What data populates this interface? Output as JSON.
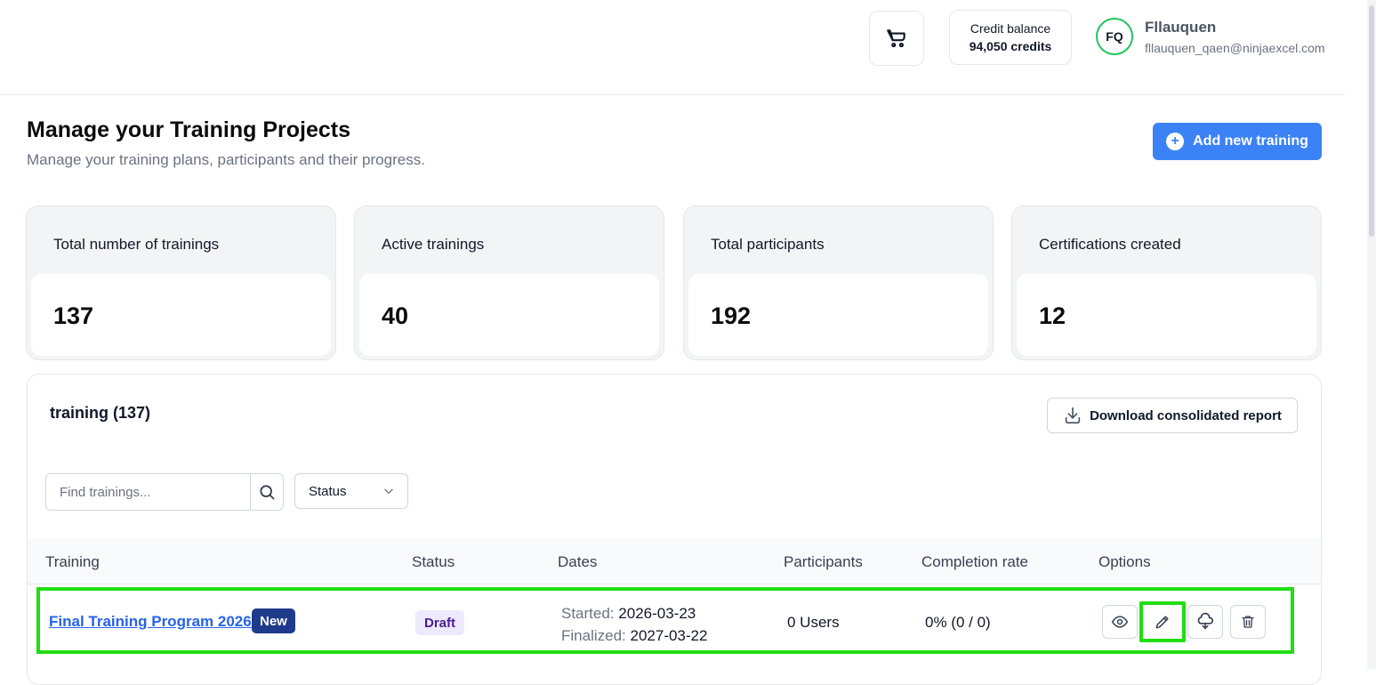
{
  "header": {
    "credit_label": "Credit balance",
    "credit_value": "94,050 credits",
    "user_initials": "FQ",
    "user_name": "Fllauquen",
    "user_email": "fllauquen_qaen@ninjaexcel.com"
  },
  "page": {
    "title": "Manage your Training Projects",
    "subtitle": "Manage your training plans, participants and their progress.",
    "add_button": "Add new training"
  },
  "stats": [
    {
      "label": "Total number of trainings",
      "value": "137"
    },
    {
      "label": "Active trainings",
      "value": "40"
    },
    {
      "label": "Total participants",
      "value": "192"
    },
    {
      "label": "Certifications created",
      "value": "12"
    }
  ],
  "table": {
    "title": "training (137)",
    "download_button": "Download consolidated report",
    "search_placeholder": "Find trainings...",
    "status_filter": "Status",
    "columns": [
      "Training",
      "Status",
      "Dates",
      "Participants",
      "Completion rate",
      "Options"
    ],
    "rows": [
      {
        "name": "Final Training Program 2026",
        "badge": "New",
        "status": "Draft",
        "started_label": "Started:",
        "started": "2026-03-23",
        "finalized_label": "Finalized:",
        "finalized": "2027-03-22",
        "participants": "0 Users",
        "completion": "0% (0 / 0)"
      }
    ]
  },
  "icons": {
    "cart": "cart-icon",
    "plus": "plus-icon",
    "download": "download-icon",
    "search": "search-icon",
    "chevron": "chevron-down-icon",
    "view": "eye-icon",
    "edit": "pencil-icon",
    "cloud": "cloud-icon",
    "delete": "trash-icon"
  },
  "colors": {
    "primary": "#3b82f6",
    "highlight": "#22dd11",
    "avatar_ring": "#22c55e",
    "badge_new": "#1e3a8a",
    "badge_draft": "#ede9fe"
  }
}
